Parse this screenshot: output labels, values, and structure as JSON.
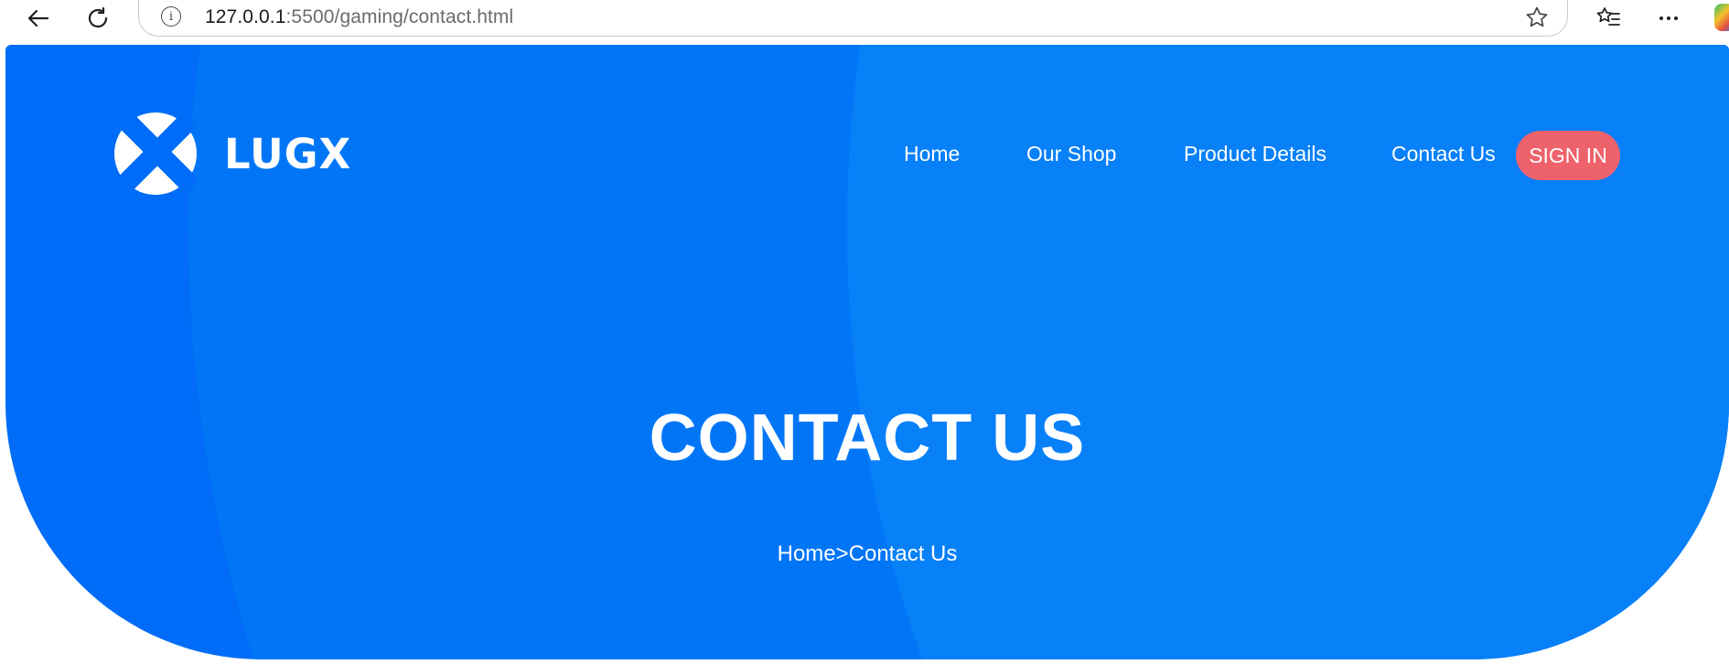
{
  "browser": {
    "url_host": "127.0.0.1",
    "url_path": ":5500/gaming/contact.html"
  },
  "header": {
    "logo_text": "LUGX",
    "nav": [
      {
        "label": "Home"
      },
      {
        "label": "Our Shop"
      },
      {
        "label": "Product Details"
      },
      {
        "label": "Contact Us"
      }
    ],
    "signin_label": "SIGN IN"
  },
  "hero": {
    "title": "CONTACT US",
    "breadcrumb_home": "Home",
    "breadcrumb_sep": ">",
    "breadcrumb_current": "Contact Us"
  },
  "colors": {
    "hero_blue": "#006cf7",
    "signin_pink": "#ee626b"
  }
}
